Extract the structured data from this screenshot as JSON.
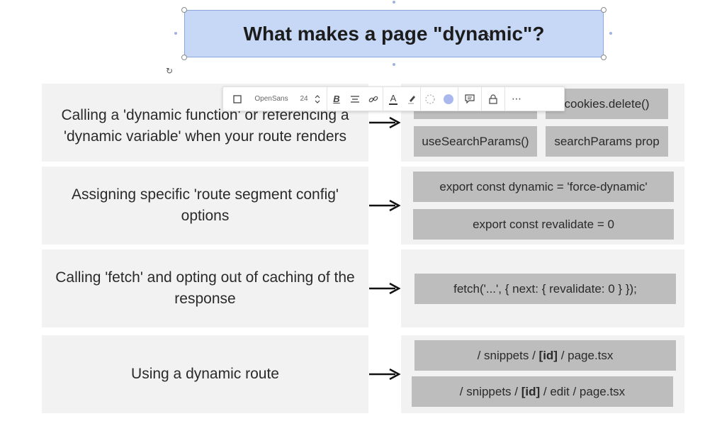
{
  "title": "What makes a page \"dynamic\"?",
  "toolbar": {
    "font_name": "OpenSans",
    "font_size": "24",
    "icons": [
      "shape-border-icon",
      "font-size-stepper-icon",
      "bold-icon",
      "align-center-icon",
      "link-icon",
      "text-color-icon",
      "highlight-icon",
      "border-style-icon",
      "fill-color-icon",
      "comment-icon",
      "lock-icon",
      "more-icon"
    ],
    "fill_color": "#a9b9ee",
    "text_color_bar": "#333333"
  },
  "rows": [
    {
      "label": "Calling a 'dynamic function' or referencing a 'dynamic variable' when your route renders",
      "items": [
        "cookies.delete()",
        "useSearchParams()",
        "searchParams prop"
      ]
    },
    {
      "label": "Assigning specific 'route segment config' options",
      "items": [
        "export const dynamic = 'force-dynamic'",
        "export const revalidate = 0"
      ]
    },
    {
      "label": "Calling 'fetch' and opting out of caching of the response",
      "items": [
        "fetch('...', { next: { revalidate: 0 } });"
      ]
    },
    {
      "label": "Using a dynamic route",
      "items": [
        {
          "pre": "/ snippets / ",
          "bold": "[id]",
          "post": " / page.tsx"
        },
        {
          "pre": "/ snippets / ",
          "bold": "[id]",
          "post": " / edit / page.tsx"
        }
      ]
    }
  ],
  "colors": {
    "title_fill": "#c7d8f7",
    "title_border": "#8aa6de",
    "panel_bg": "#f2f2f2",
    "code_bg": "#bdbdbd"
  }
}
